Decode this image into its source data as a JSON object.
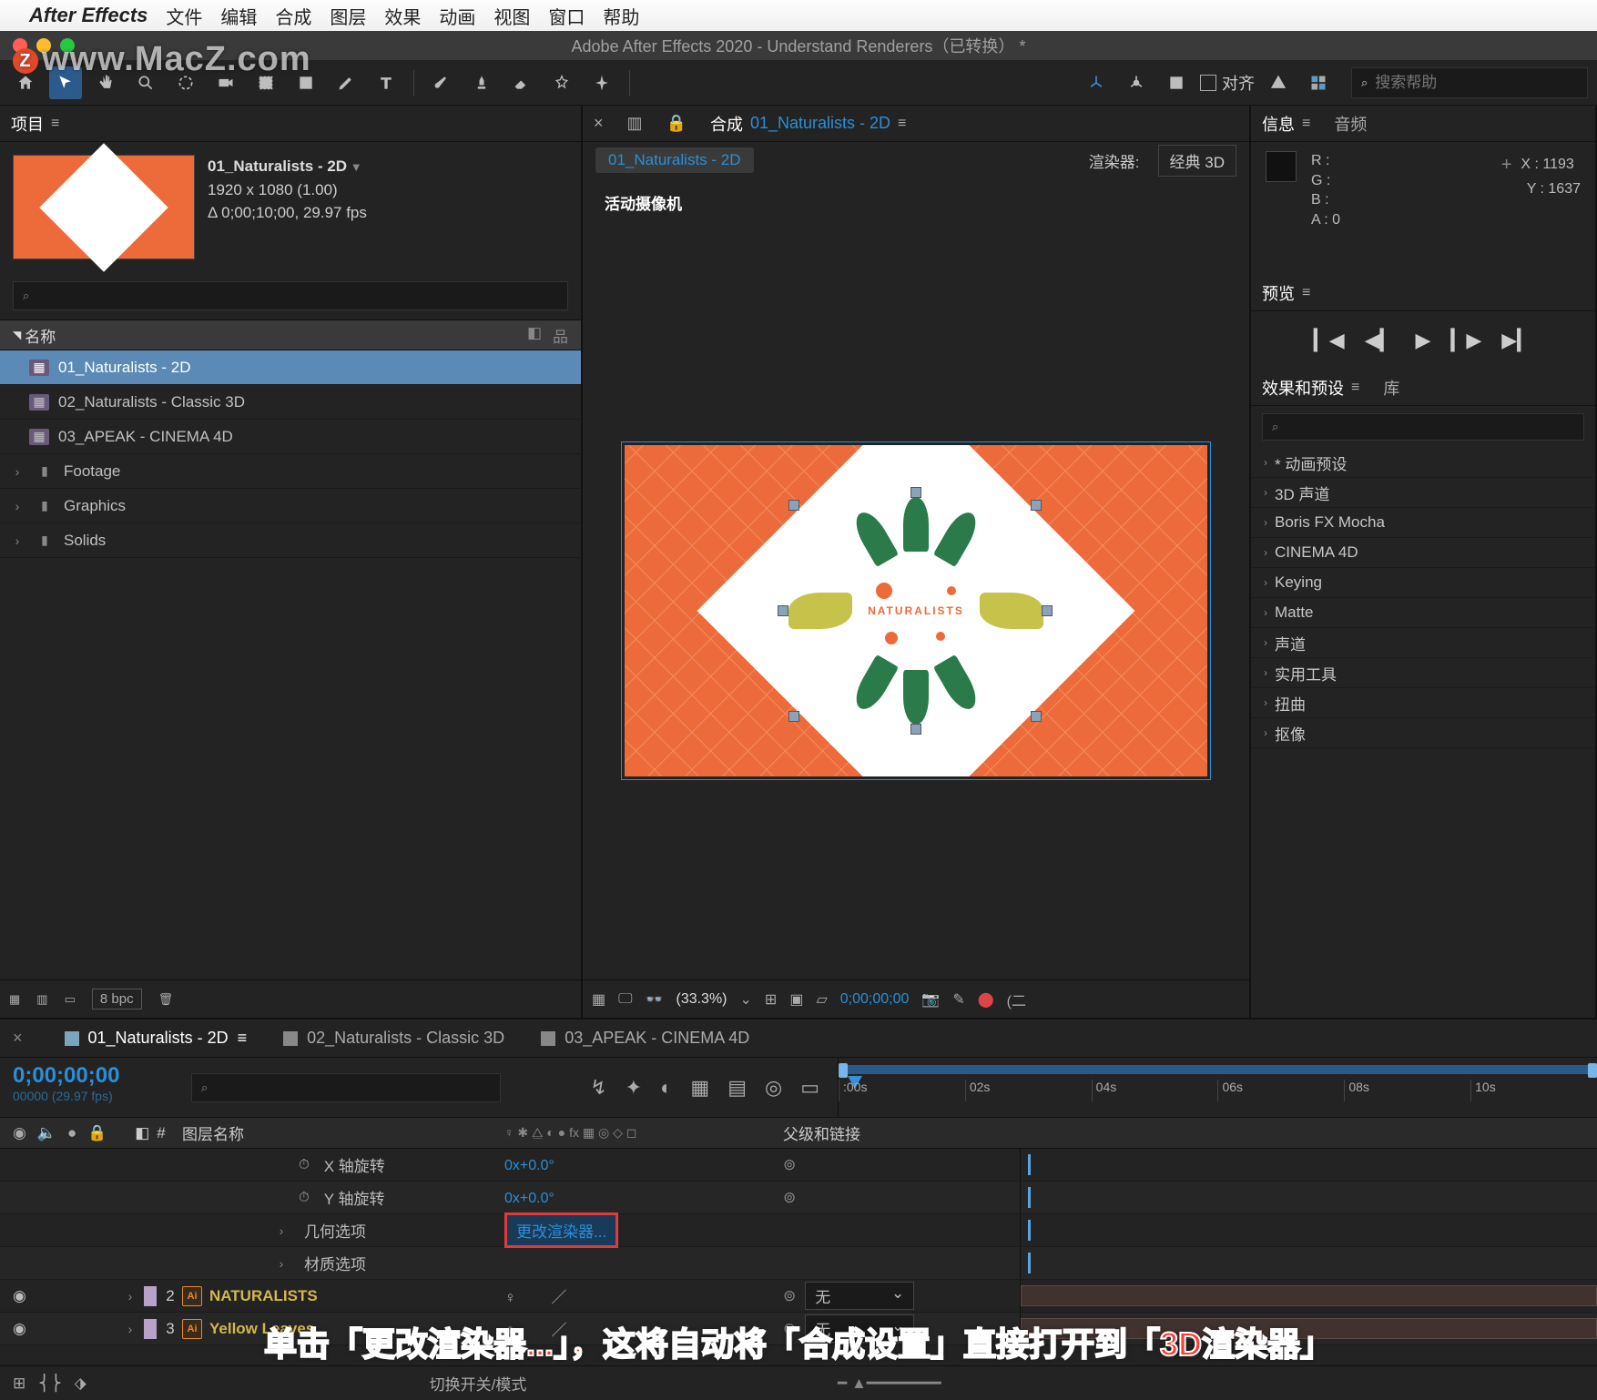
{
  "mac_menu": {
    "apple": "",
    "app": "After Effects",
    "items": [
      "文件",
      "编辑",
      "合成",
      "图层",
      "效果",
      "动画",
      "视图",
      "窗口",
      "帮助"
    ]
  },
  "title_bar": "Adobe After Effects 2020 - Understand Renderers（已转换） *",
  "toolbar": {
    "align_label": "对齐",
    "search_placeholder": "搜索帮助"
  },
  "project": {
    "tab": "项目",
    "item_name": "01_Naturalists - 2D",
    "res": "1920 x 1080 (1.00)",
    "dur": "Δ 0;00;10;00, 29.97 fps",
    "col_name": "名称",
    "rows": [
      {
        "type": "comp",
        "label": "01_Naturalists - 2D",
        "sel": true
      },
      {
        "type": "comp",
        "label": "02_Naturalists - Classic 3D"
      },
      {
        "type": "comp",
        "label": "03_APEAK - CINEMA 4D"
      },
      {
        "type": "folder",
        "label": "Footage"
      },
      {
        "type": "folder",
        "label": "Graphics"
      },
      {
        "type": "folder",
        "label": "Solids"
      }
    ],
    "bpc": "8 bpc"
  },
  "comp_panel": {
    "tab_prefix": "合成",
    "tab_name": "01_Naturalists - 2D",
    "chip": "01_Naturalists - 2D",
    "renderer_label": "渲染器:",
    "renderer_value": "经典 3D",
    "view_label": "活动摄像机",
    "center_text": "NATURALISTS",
    "zoom": "(33.3%)",
    "timecode": "0;00;00;00",
    "footer_chip": "(二"
  },
  "info_panel": {
    "tab_info": "信息",
    "tab_audio": "音频",
    "r": "R :",
    "g": "G :",
    "b": "B :",
    "a": "A :  0",
    "x": "X : 1193",
    "y": "Y : 1637"
  },
  "preview_panel": {
    "tab": "预览"
  },
  "effects_panel": {
    "tab_eff": "效果和预设",
    "tab_lib": "库",
    "rows": [
      "* 动画预设",
      "3D 声道",
      "Boris FX Mocha",
      "CINEMA 4D",
      "Keying",
      "Matte",
      "声道",
      "实用工具",
      "扭曲",
      "抠像"
    ]
  },
  "timeline": {
    "tabs": [
      "01_Naturalists - 2D",
      "02_Naturalists - Classic 3D",
      "03_APEAK - CINEMA 4D"
    ],
    "timecode": "0;00;00;00",
    "sub": "00000 (29.97 fps)",
    "ticks": [
      ":00s",
      "02s",
      "04s",
      "06s",
      "08s",
      "10s"
    ],
    "cols": {
      "layer": "图层名称",
      "parent": "父级和链接",
      "numhash": "#"
    },
    "prop_x": "X 轴旋转",
    "prop_y": "Y 轴旋转",
    "prop_x_val": "0x+0.0°",
    "prop_y_val": "0x+0.0°",
    "prop_geo": "几何选项",
    "prop_mat": "材质选项",
    "renderer_btn": "更改渲染器...",
    "layer2": {
      "num": "2",
      "name": "NATURALISTS",
      "parent": "无"
    },
    "layer3": {
      "num": "3",
      "name": "Yellow Leaves",
      "parent": "无"
    },
    "footer_switch": "切换开关/模式"
  },
  "callout_tip": "单击",
  "subtitle": "单击「更改渲染器...」，这将自动将「合成设置」直接打开到「3D渲染器」",
  "watermark": "www.MacZ.com"
}
